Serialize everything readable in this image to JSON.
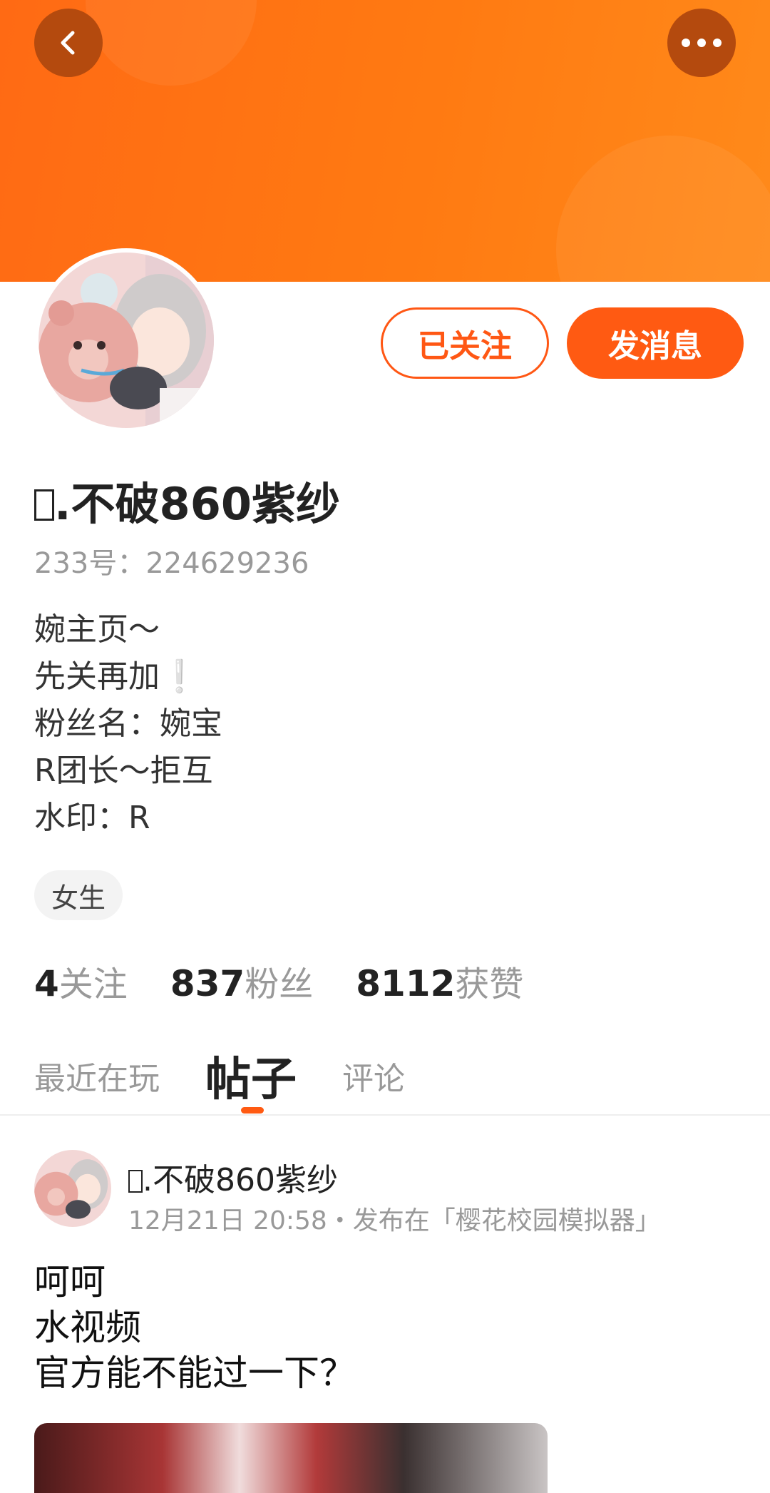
{
  "header": {
    "back_icon": "chevron-left-icon",
    "more_icon": "more-horizontal-icon",
    "banner_color": "#ff6a14"
  },
  "profile": {
    "avatar_icon": "avatar-anime-girl-with-bear",
    "follow_label": "已关注",
    "message_label": "发消息",
    "name": ".不破860紫纱",
    "id_text": "233号：224629236",
    "bio": [
      "婉主页～",
      "先关再加",
      "粉丝名：婉宝",
      "R团长～拒互",
      "水印：R"
    ],
    "bio_emoji": "❕",
    "gender_tag": "女生"
  },
  "stats": {
    "following": {
      "value": "4",
      "label": "关注"
    },
    "fans": {
      "value": "837",
      "label": "粉丝"
    },
    "likes": {
      "value": "8112",
      "label": "获赞"
    }
  },
  "tabs": [
    {
      "label": "最近在玩"
    },
    {
      "label": "帖子",
      "active": true
    },
    {
      "label": "评论"
    }
  ],
  "post": {
    "author": ".不破860紫纱",
    "meta": "12月21日 20:58・发布在「樱花校园模拟器」",
    "lines": [
      "呵呵",
      "水视频",
      "官方能不能过一下？"
    ]
  },
  "colors": {
    "accent": "#ff5a12",
    "link_blue": "#33b4f0"
  }
}
